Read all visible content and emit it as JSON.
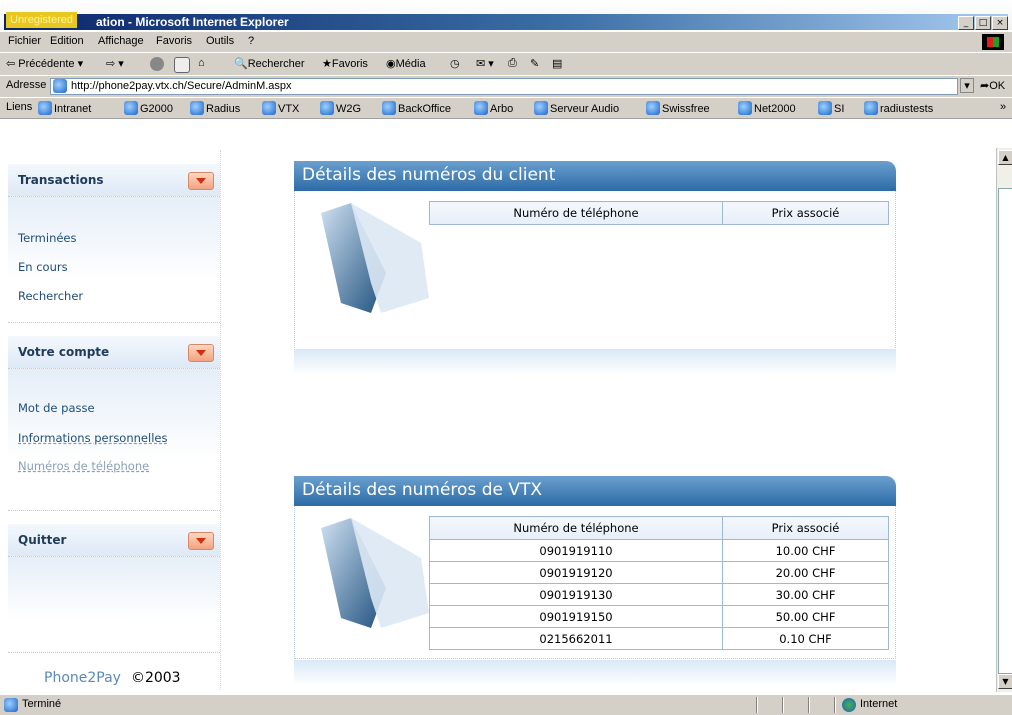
{
  "window": {
    "logo_text": "Unregistered",
    "title": "ation - Microsoft Internet Explorer"
  },
  "menu": [
    "Fichier",
    "Edition",
    "Affichage",
    "Favoris",
    "Outils",
    "?"
  ],
  "toolbar": {
    "back": "Précédente",
    "search": "Rechercher",
    "favorites": "Favoris",
    "media": "Média"
  },
  "address": {
    "label": "Adresse",
    "url": "http://phone2pay.vtx.ch/Secure/AdminM.aspx",
    "go": "OK"
  },
  "links": {
    "label": "Liens",
    "items": [
      "Intranet",
      "G2000",
      "Radius",
      "VTX",
      "W2G",
      "BackOffice",
      "Arbo",
      "Serveur Audio",
      "Swissfree",
      "Net2000",
      "SI",
      "radiustests"
    ]
  },
  "sidebar": {
    "transactions": {
      "title": "Transactions",
      "items": [
        "Terminées",
        "En cours",
        "Rechercher"
      ]
    },
    "account": {
      "title": "Votre compte",
      "items": [
        "Mot de passe",
        "Informations personnelles",
        "Numéros de téléphone"
      ]
    },
    "quit": {
      "title": "Quitter"
    },
    "footer": {
      "brand": "Phone2Pay",
      "copyright": "©2003"
    }
  },
  "client_panel": {
    "title": "Détails des numéros du client",
    "col_phone": "Numéro de téléphone",
    "col_price": "Prix associé",
    "rows": []
  },
  "vtx_panel": {
    "title": "Détails des numéros de VTX",
    "col_phone": "Numéro de téléphone",
    "col_price": "Prix associé",
    "rows": [
      {
        "phone": "0901919110",
        "price": "10.00 CHF"
      },
      {
        "phone": "0901919120",
        "price": "20.00 CHF"
      },
      {
        "phone": "0901919130",
        "price": "30.00 CHF"
      },
      {
        "phone": "0901919150",
        "price": "50.00 CHF"
      },
      {
        "phone": "0215662011",
        "price": "0.10 CHF"
      }
    ]
  },
  "status": {
    "text": "Terminé",
    "zone": "Internet"
  }
}
